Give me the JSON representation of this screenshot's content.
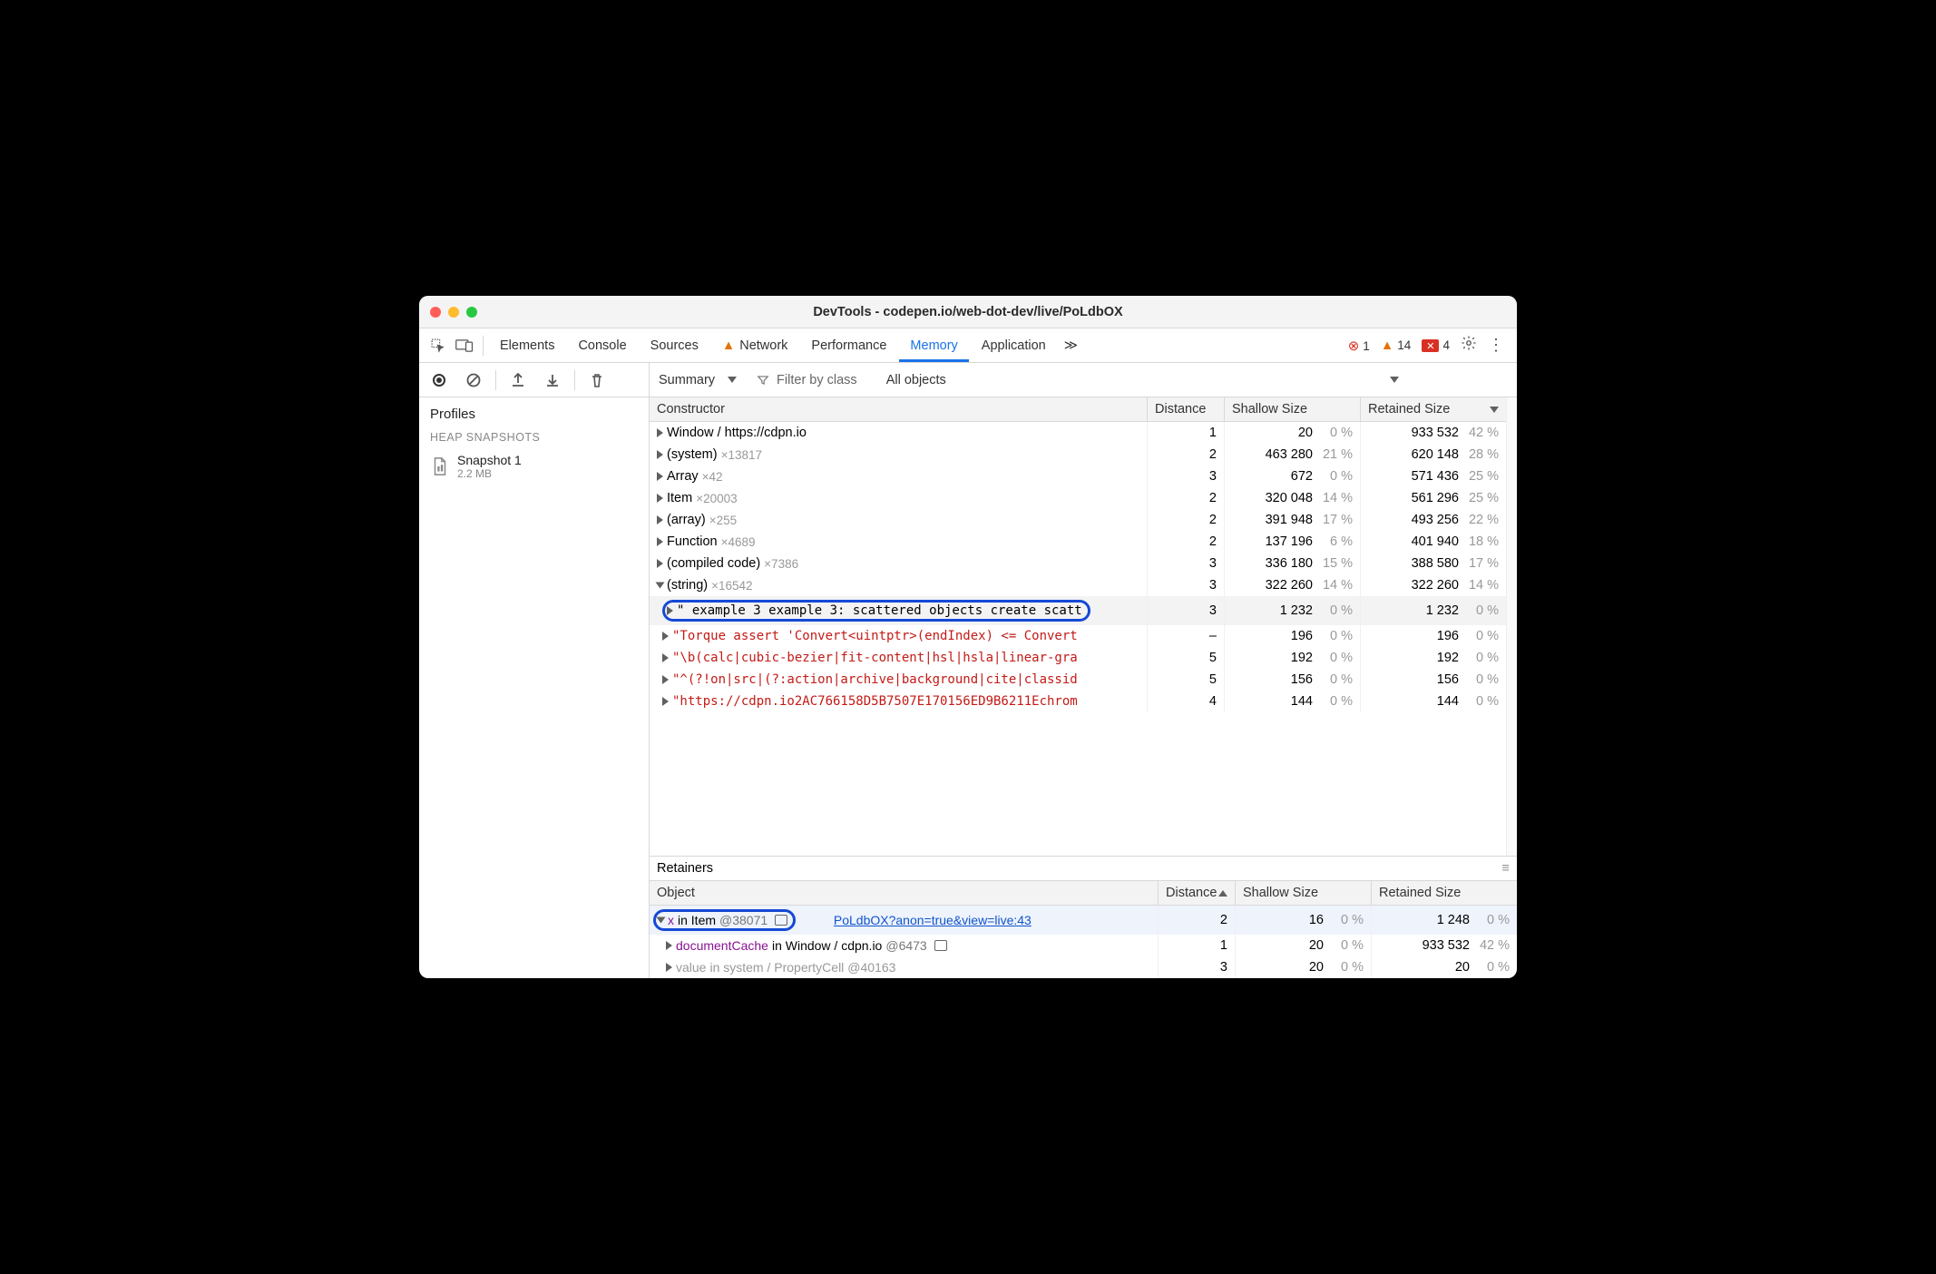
{
  "title": "DevTools - codepen.io/web-dot-dev/live/PoLdbOX",
  "tabs": [
    "Elements",
    "Console",
    "Sources",
    "Network",
    "Performance",
    "Memory",
    "Application"
  ],
  "active_tab": "Memory",
  "error_count": "1",
  "warn_count": "14",
  "violation_count": "4",
  "left": {
    "profiles_label": "Profiles",
    "group_label": "HEAP SNAPSHOTS",
    "snapshot": {
      "name": "Snapshot 1",
      "size": "2.2 MB"
    }
  },
  "rtoolbar": {
    "view": "Summary",
    "filter_placeholder": "Filter by class",
    "scope": "All objects"
  },
  "cols": {
    "c1": "Constructor",
    "c2": "Distance",
    "c3": "Shallow Size",
    "c4": "Retained Size"
  },
  "rows": [
    {
      "name": "Window / https://cdpn.io",
      "count": "",
      "dist": "1",
      "shallow": "20",
      "spct": "0 %",
      "ret": "933 532",
      "rpct": "42 %",
      "kind": "t",
      "ind": 0
    },
    {
      "name": "(system)",
      "count": "×13817",
      "dist": "2",
      "shallow": "463 280",
      "spct": "21 %",
      "ret": "620 148",
      "rpct": "28 %",
      "kind": "t",
      "ind": 0
    },
    {
      "name": "Array",
      "count": "×42",
      "dist": "3",
      "shallow": "672",
      "spct": "0 %",
      "ret": "571 436",
      "rpct": "25 %",
      "kind": "t",
      "ind": 0
    },
    {
      "name": "Item",
      "count": "×20003",
      "dist": "2",
      "shallow": "320 048",
      "spct": "14 %",
      "ret": "561 296",
      "rpct": "25 %",
      "kind": "t",
      "ind": 0
    },
    {
      "name": "(array)",
      "count": "×255",
      "dist": "2",
      "shallow": "391 948",
      "spct": "17 %",
      "ret": "493 256",
      "rpct": "22 %",
      "kind": "t",
      "ind": 0
    },
    {
      "name": "Function",
      "count": "×4689",
      "dist": "2",
      "shallow": "137 196",
      "spct": "6 %",
      "ret": "401 940",
      "rpct": "18 %",
      "kind": "t",
      "ind": 0
    },
    {
      "name": "(compiled code)",
      "count": "×7386",
      "dist": "3",
      "shallow": "336 180",
      "spct": "15 %",
      "ret": "388 580",
      "rpct": "17 %",
      "kind": "t",
      "ind": 0
    },
    {
      "name": "(string)",
      "count": "×16542",
      "dist": "3",
      "shallow": "322 260",
      "spct": "14 %",
      "ret": "322 260",
      "rpct": "14 %",
      "kind": "open",
      "ind": 0
    },
    {
      "name": "\" example 3 example 3: scattered objects create scatt",
      "count": "",
      "dist": "3",
      "shallow": "1 232",
      "spct": "0 %",
      "ret": "1 232",
      "rpct": "0 %",
      "kind": "hl",
      "ind": 1
    },
    {
      "name": "\"Torque assert 'Convert<uintptr>(endIndex) <= Convert",
      "count": "",
      "dist": "–",
      "shallow": "196",
      "spct": "0 %",
      "ret": "196",
      "rpct": "0 %",
      "kind": "str",
      "ind": 1
    },
    {
      "name": "\"\\b(calc|cubic-bezier|fit-content|hsl|hsla|linear-gra",
      "count": "",
      "dist": "5",
      "shallow": "192",
      "spct": "0 %",
      "ret": "192",
      "rpct": "0 %",
      "kind": "str",
      "ind": 1
    },
    {
      "name": "\"^(?!on|src|(?:action|archive|background|cite|classid",
      "count": "",
      "dist": "5",
      "shallow": "156",
      "spct": "0 %",
      "ret": "156",
      "rpct": "0 %",
      "kind": "str",
      "ind": 1
    },
    {
      "name": "\"https://cdpn.io2AC766158D5B7507E170156ED9B6211Echrom",
      "count": "",
      "dist": "4",
      "shallow": "144",
      "spct": "0 %",
      "ret": "144",
      "rpct": "0 %",
      "kind": "str",
      "ind": 1
    }
  ],
  "retainers": {
    "title": "Retainers",
    "cols": {
      "c1": "Object",
      "c2": "Distance",
      "c3": "Shallow Size",
      "c4": "Retained Size"
    },
    "rows": [
      {
        "key": "x",
        "mid": " in Item ",
        "ref": "@38071",
        "link": "PoLdbOX?anon=true&view=live:43",
        "dist": "2",
        "shallow": "16",
        "spct": "0 %",
        "ret": "1 248",
        "rpct": "0 %",
        "sel": true,
        "hl": true,
        "open": true
      },
      {
        "key": "documentCache",
        "mid": " in Window / cdpn.io ",
        "ref": "@6473",
        "link": "",
        "dist": "1",
        "shallow": "20",
        "spct": "0 %",
        "ret": "933 532",
        "rpct": "42 %",
        "sel": false,
        "hl": false,
        "open": false,
        "sq": true
      },
      {
        "key": "value",
        "mid": " in system / PropertyCell ",
        "ref": "@40163",
        "link": "",
        "dist": "3",
        "shallow": "20",
        "spct": "0 %",
        "ret": "20",
        "rpct": "0 %",
        "sel": false,
        "hl": false,
        "open": false,
        "dim": true
      }
    ]
  }
}
